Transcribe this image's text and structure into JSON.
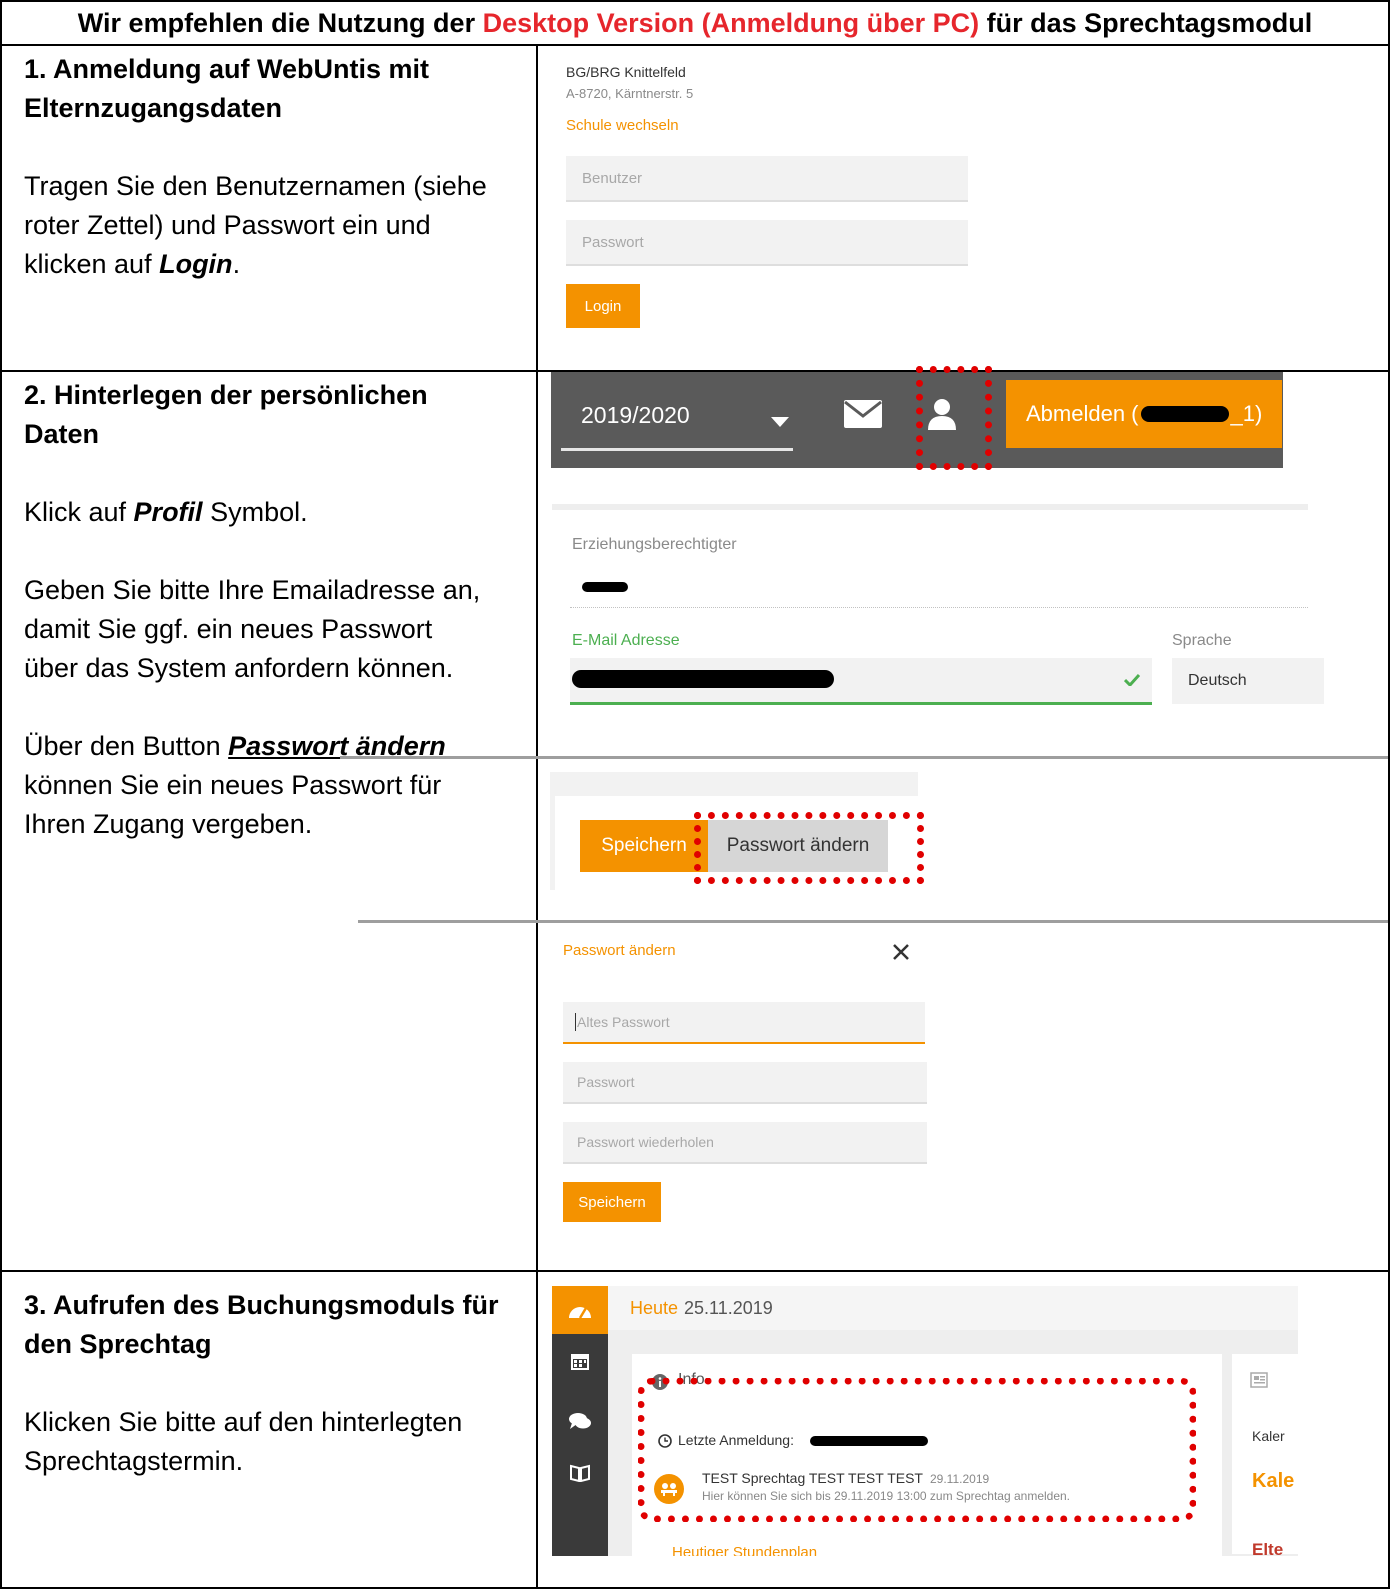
{
  "header": {
    "prefix": "Wir empfehlen die Nutzung der ",
    "highlight": "Desktop Version (Anmeldung über PC)",
    "suffix": " für das Sprechtagsmodul",
    "highlight_color": "#e6262c"
  },
  "step1": {
    "title_line1": "1. Anmeldung auf WebUntis mit",
    "title_line2": "Elternzugangsdaten",
    "desc_line1": "Tragen Sie den Benutzernamen (siehe",
    "desc_line2": "roter Zettel) und Passwort ein und",
    "desc_line3_prefix": "klicken auf ",
    "desc_line3_em": "Login",
    "desc_line3_suffix": ".",
    "school_name": "BG/BRG Knittelfeld",
    "school_address": "A-8720, Kärntnerstr. 5",
    "change_school": "Schule wechseln",
    "user_placeholder": "Benutzer",
    "password_placeholder": "Passwort",
    "login_label": "Login"
  },
  "step2": {
    "title_line1": "2. Hinterlegen der persönlichen",
    "title_line2": "Daten",
    "desc1_prefix": "Klick auf ",
    "desc1_em": "Profil",
    "desc1_suffix": " Symbol.",
    "desc2_line1": "Geben Sie bitte Ihre Emailadresse an,",
    "desc2_line2": "damit Sie ggf. ein neues Passwort",
    "desc2_line3": "über das System anfordern können.",
    "desc3_prefix": "Über den Button ",
    "desc3_em": "Passwort ändern",
    "desc3_line2": "können Sie ein neues Passwort für",
    "desc3_line3": "Ihren Zugang vergeben.",
    "school_year": "2019/2020",
    "logout_prefix": "Abmelden (",
    "logout_suffix": "_1)",
    "guardian_label": "Erziehungsberechtigter",
    "email_label": "E-Mail Adresse",
    "language_label": "Sprache",
    "language_value": "Deutsch",
    "save_label": "Speichern",
    "change_password_label": "Passwort ändern",
    "dialog_title": "Passwort ändern",
    "old_password_placeholder": "Altes Passwort",
    "new_password_placeholder": "Passwort",
    "repeat_password_placeholder": "Passwort wiederholen",
    "dialog_save_label": "Speichern"
  },
  "step3": {
    "title_line1": "3. Aufrufen des Buchungsmoduls für",
    "title_line2": "den Sprechtag",
    "desc_line1": "Klicken Sie bitte auf den hinterlegten",
    "desc_line2": "Sprechtagstermin.",
    "today_label": "Heute",
    "today_date": "25.11.2019",
    "info_label": "Info",
    "last_login_label": "Letzte Anmeldung:",
    "event_title": "TEST Sprechtag TEST TEST TEST",
    "event_date": "29.11.2019",
    "event_desc": "Hier können Sie sich bis 29.11.2019 13:00 zum Sprechtag anmelden.",
    "right_text1": "Kaler",
    "right_text2": "Kale",
    "bottom_text": "Heutiger Stundenplan",
    "bottom_right": "Elte"
  }
}
